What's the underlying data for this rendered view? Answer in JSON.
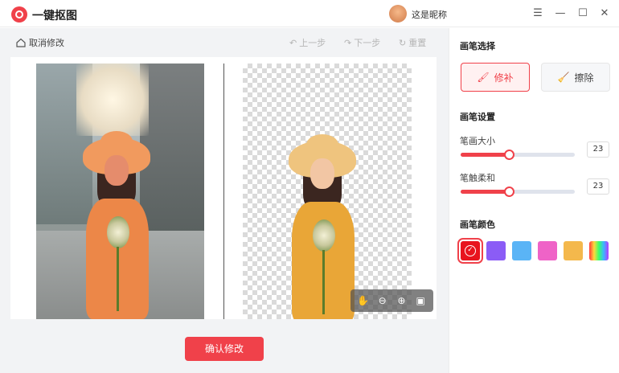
{
  "app": {
    "title": "一键抠图",
    "nickname": "这是昵称"
  },
  "window_controls": {
    "menu": "☰",
    "minimize": "—",
    "maximize": "☐",
    "close": "✕"
  },
  "toolbar": {
    "cancel_label": "取消修改",
    "undo_label": "上一步",
    "redo_label": "下一步",
    "reset_label": "重置"
  },
  "canvas": {
    "zoom_tools": [
      "hand-icon",
      "zoom-out-icon",
      "zoom-in-icon",
      "fit-icon"
    ]
  },
  "confirm_label": "确认修改",
  "panel": {
    "brush_select_title": "画笔选择",
    "brush_repair_label": "修补",
    "brush_erase_label": "擦除",
    "brush_settings_title": "画笔设置",
    "brush_size_label": "笔画大小",
    "brush_size_value": "23",
    "brush_size_fraction": 0.42,
    "brush_soft_label": "笔触柔和",
    "brush_soft_value": "23",
    "brush_soft_fraction": 0.42,
    "brush_color_title": "画笔颜色",
    "colors": [
      "#e8141e",
      "#8b5cf6",
      "#5ab4f6",
      "#ef63c7",
      "#f4b84c",
      "rainbow"
    ],
    "selected_color_index": 0
  },
  "accent_color": "#f0414a"
}
